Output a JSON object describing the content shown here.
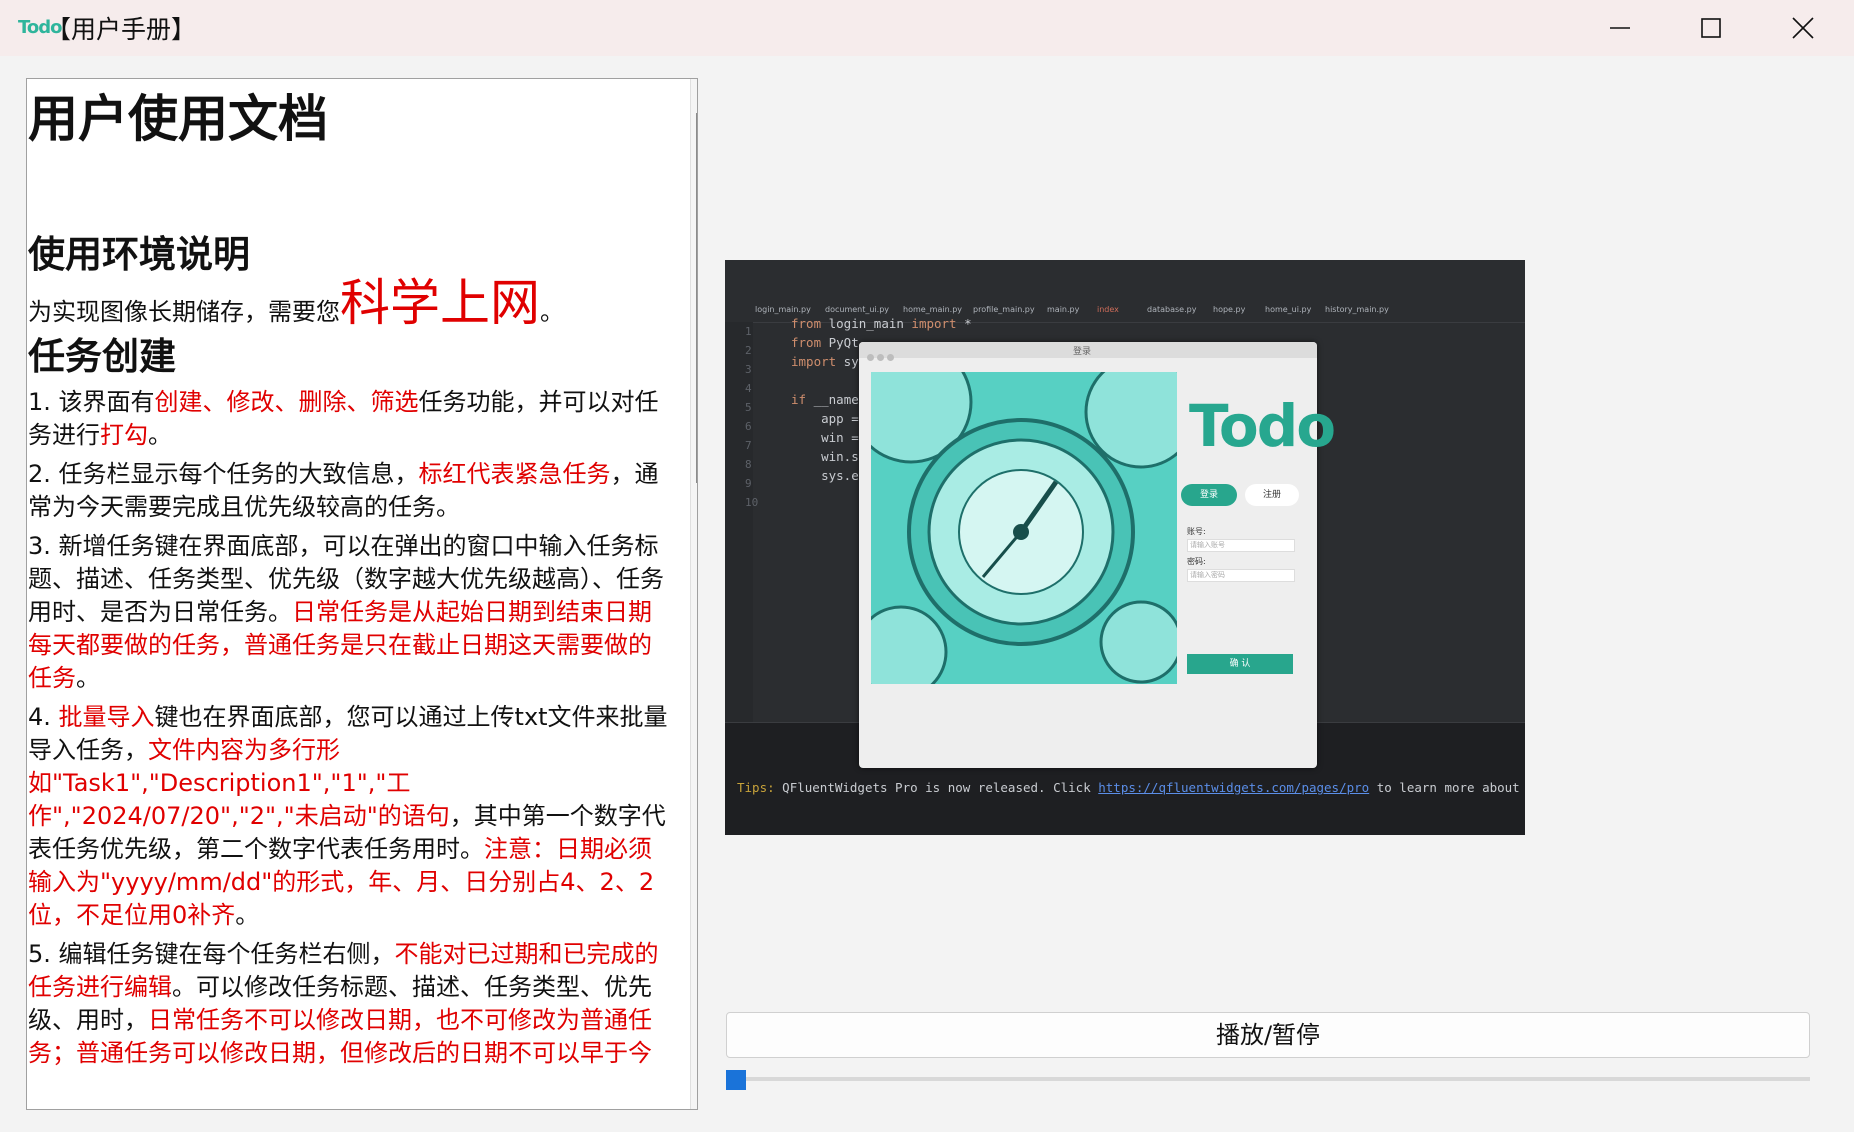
{
  "window": {
    "logo_text": "Todo",
    "title": "【用户手册】"
  },
  "doc": {
    "title": "用户使用文档",
    "section_env": "使用环境说明",
    "env_text": "为实现图像长期储存，需要您",
    "env_highlight": "科学上网",
    "env_end": "。",
    "section_task": "任务创建",
    "p1_a": "1. 该界面有",
    "p1_red": "创建、修改、删除、筛选",
    "p1_b": "任务功能，并可以对任务进行",
    "p1_red2": "打勾",
    "p1_c": "。",
    "p2_a": "2. 任务栏显示每个任务的大致信息，",
    "p2_red": "标红代表紧急任务",
    "p2_b": "，通常为今天需要完成且优先级较高的任务。",
    "p3_a": "3. 新增任务键在界面底部，可以在弹出的窗口中输入任务标题、描述、任务类型、优先级（数字越大优先级越高）、任务用时、是否为日常任务。",
    "p3_red": "日常任务是从起始日期到结束日期每天都要做的任务，普通任务是只在截止日期这天需要做的任务",
    "p3_b": "。",
    "p4_a": "4. ",
    "p4_red": "批量导入",
    "p4_b": "键也在界面底部，您可以通过上传txt文件来批量导入任务，",
    "p4_red2": "文件内容为多行形如\"Task1\",\"Description1\",\"1\",\"工作\",\"2024/07/20\",\"2\",\"未启动\"的语句",
    "p4_c": "，其中第一个数字代表任务优先级，第二个数字代表任务用时。",
    "p4_red3": "注意：日期必须输入为\"yyyy/mm/dd\"的形式，年、月、日分别占4、2、2位，不足位用0补齐",
    "p4_d": "。",
    "p5_a": "5. 编辑任务键在每个任务栏右侧，",
    "p5_red": "不能对已过期和已完成的任务进行编辑",
    "p5_b": "。可以修改任务标题、描述、任务类型、优先级、用时，",
    "p5_red2": "日常任务不可以修改日期，也不可修改为普通任务；普通任务可以修改日期，但修改后的日期不可以早于今"
  },
  "video": {
    "tabs": [
      "login_main.py",
      "document_ui.py",
      "home_main.py",
      "profile_main.py",
      "main.py",
      "index",
      "database.py",
      "hope.py",
      "home_ui.py",
      "history_main.py"
    ],
    "line_numbers": [
      "1",
      "2",
      "3",
      "4",
      "5",
      "6",
      "7",
      "8",
      "9",
      "10"
    ],
    "code_l1_kw1": "from",
    "code_l1_mid": " login_main ",
    "code_l1_kw2": "import",
    "code_l1_end": " *",
    "code_l2_kw": "from",
    "code_l2_rest": " PyQt",
    "code_l3_kw": "import",
    "code_l3_rest": " sy",
    "code_l5_kw": "if",
    "code_l5_rest": " __name",
    "code_l6": "    app =",
    "code_l7": "    win =",
    "code_l8": "    win.s",
    "code_l9": "    sys.e",
    "tips_label": "Tips:",
    "tips_text": " QFluentWidgets Pro is now released. Click ",
    "tips_link": "https://qfluentwidgets.com/pages/pro",
    "tips_end": " to learn more about it.",
    "dialog_title": "登录",
    "dialog_logo": "Todo",
    "login_tab": "登录",
    "register_tab": "注册",
    "account_label": "账号:",
    "account_placeholder": "请输入账号",
    "password_label": "密码:",
    "password_placeholder": "请输入密码",
    "confirm_button": "确 认"
  },
  "controls": {
    "play_pause_label": "播放/暂停",
    "progress": 0.0
  },
  "colors": {
    "highlight_red": "#e00000",
    "accent_teal": "#28a68d",
    "slider_blue": "#1a73d9"
  }
}
